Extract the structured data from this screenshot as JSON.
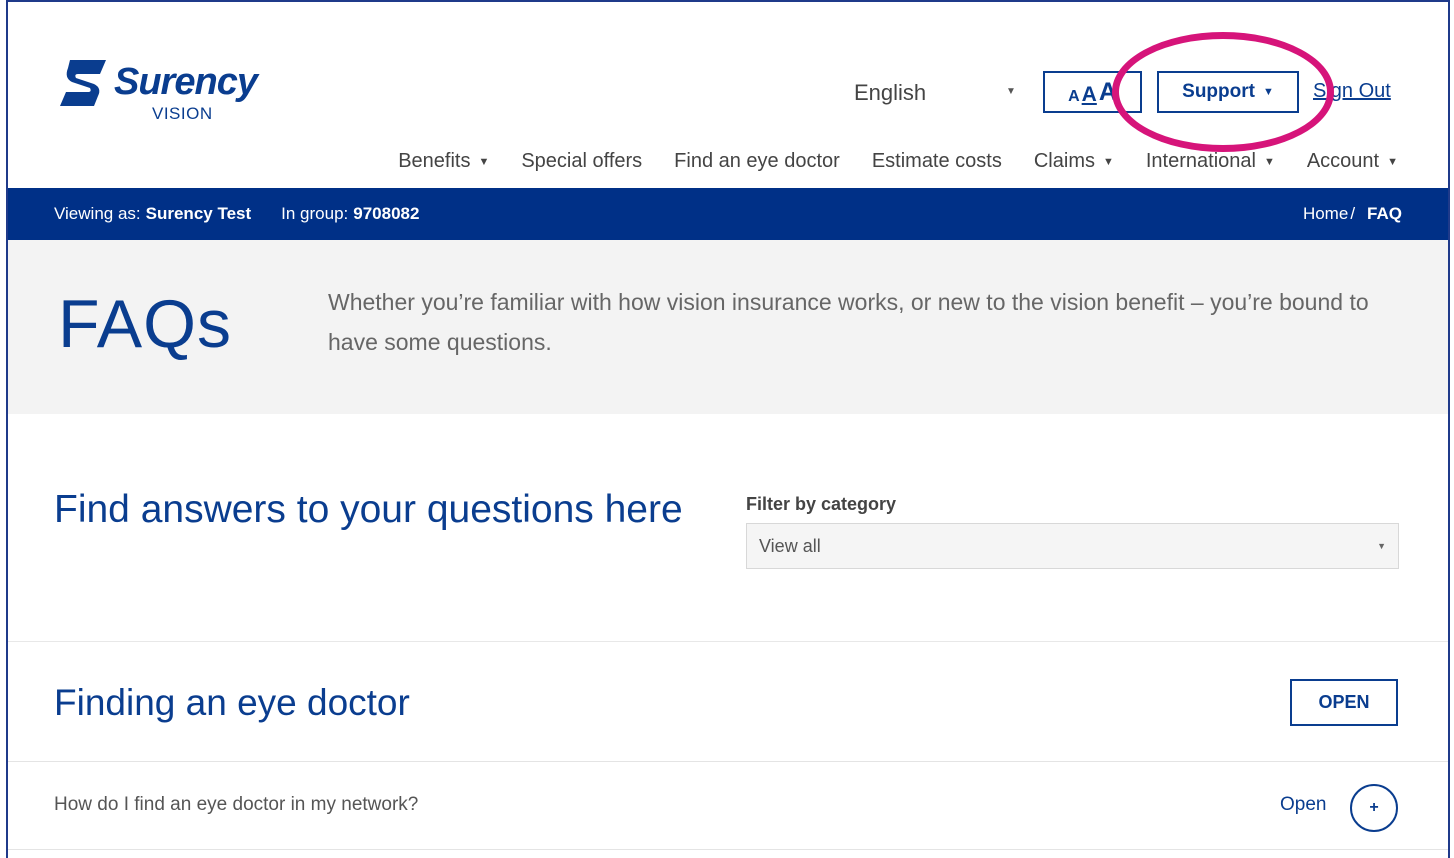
{
  "brand": {
    "name": "Surency",
    "sub": "VISION",
    "color": "#0a3d8f"
  },
  "topbar": {
    "language": "English",
    "text_size": [
      "A",
      "A",
      "A"
    ],
    "support_label": "Support",
    "signout_label": "Sign Out"
  },
  "nav": {
    "items": [
      {
        "label": "Benefits",
        "dropdown": true
      },
      {
        "label": "Special offers",
        "dropdown": false
      },
      {
        "label": "Find an eye doctor",
        "dropdown": false
      },
      {
        "label": "Estimate costs",
        "dropdown": false
      },
      {
        "label": "Claims",
        "dropdown": true
      },
      {
        "label": "International",
        "dropdown": true
      },
      {
        "label": "Account",
        "dropdown": true
      }
    ]
  },
  "infobar": {
    "viewing_label": "Viewing as:",
    "viewing_value": "Surency Test",
    "group_label": "In group:",
    "group_value": "9708082",
    "breadcrumb_home": "Home",
    "breadcrumb_sep": "/",
    "breadcrumb_current": "FAQ",
    "color": "#003087"
  },
  "hero": {
    "title": "FAQs",
    "text": "Whether you’re familiar with how vision insurance works, or new to the vision benefit – you’re bound to have some questions."
  },
  "find": {
    "title": "Find answers to your questions here",
    "filter_label": "Filter by category",
    "filter_value": "View all"
  },
  "section": {
    "title": "Finding an eye doctor",
    "open_label": "OPEN"
  },
  "questions": [
    {
      "text": "How do I find an eye doctor in my network?",
      "open_label": "Open",
      "icon": "+"
    }
  ],
  "highlight_color": "#d6147a"
}
